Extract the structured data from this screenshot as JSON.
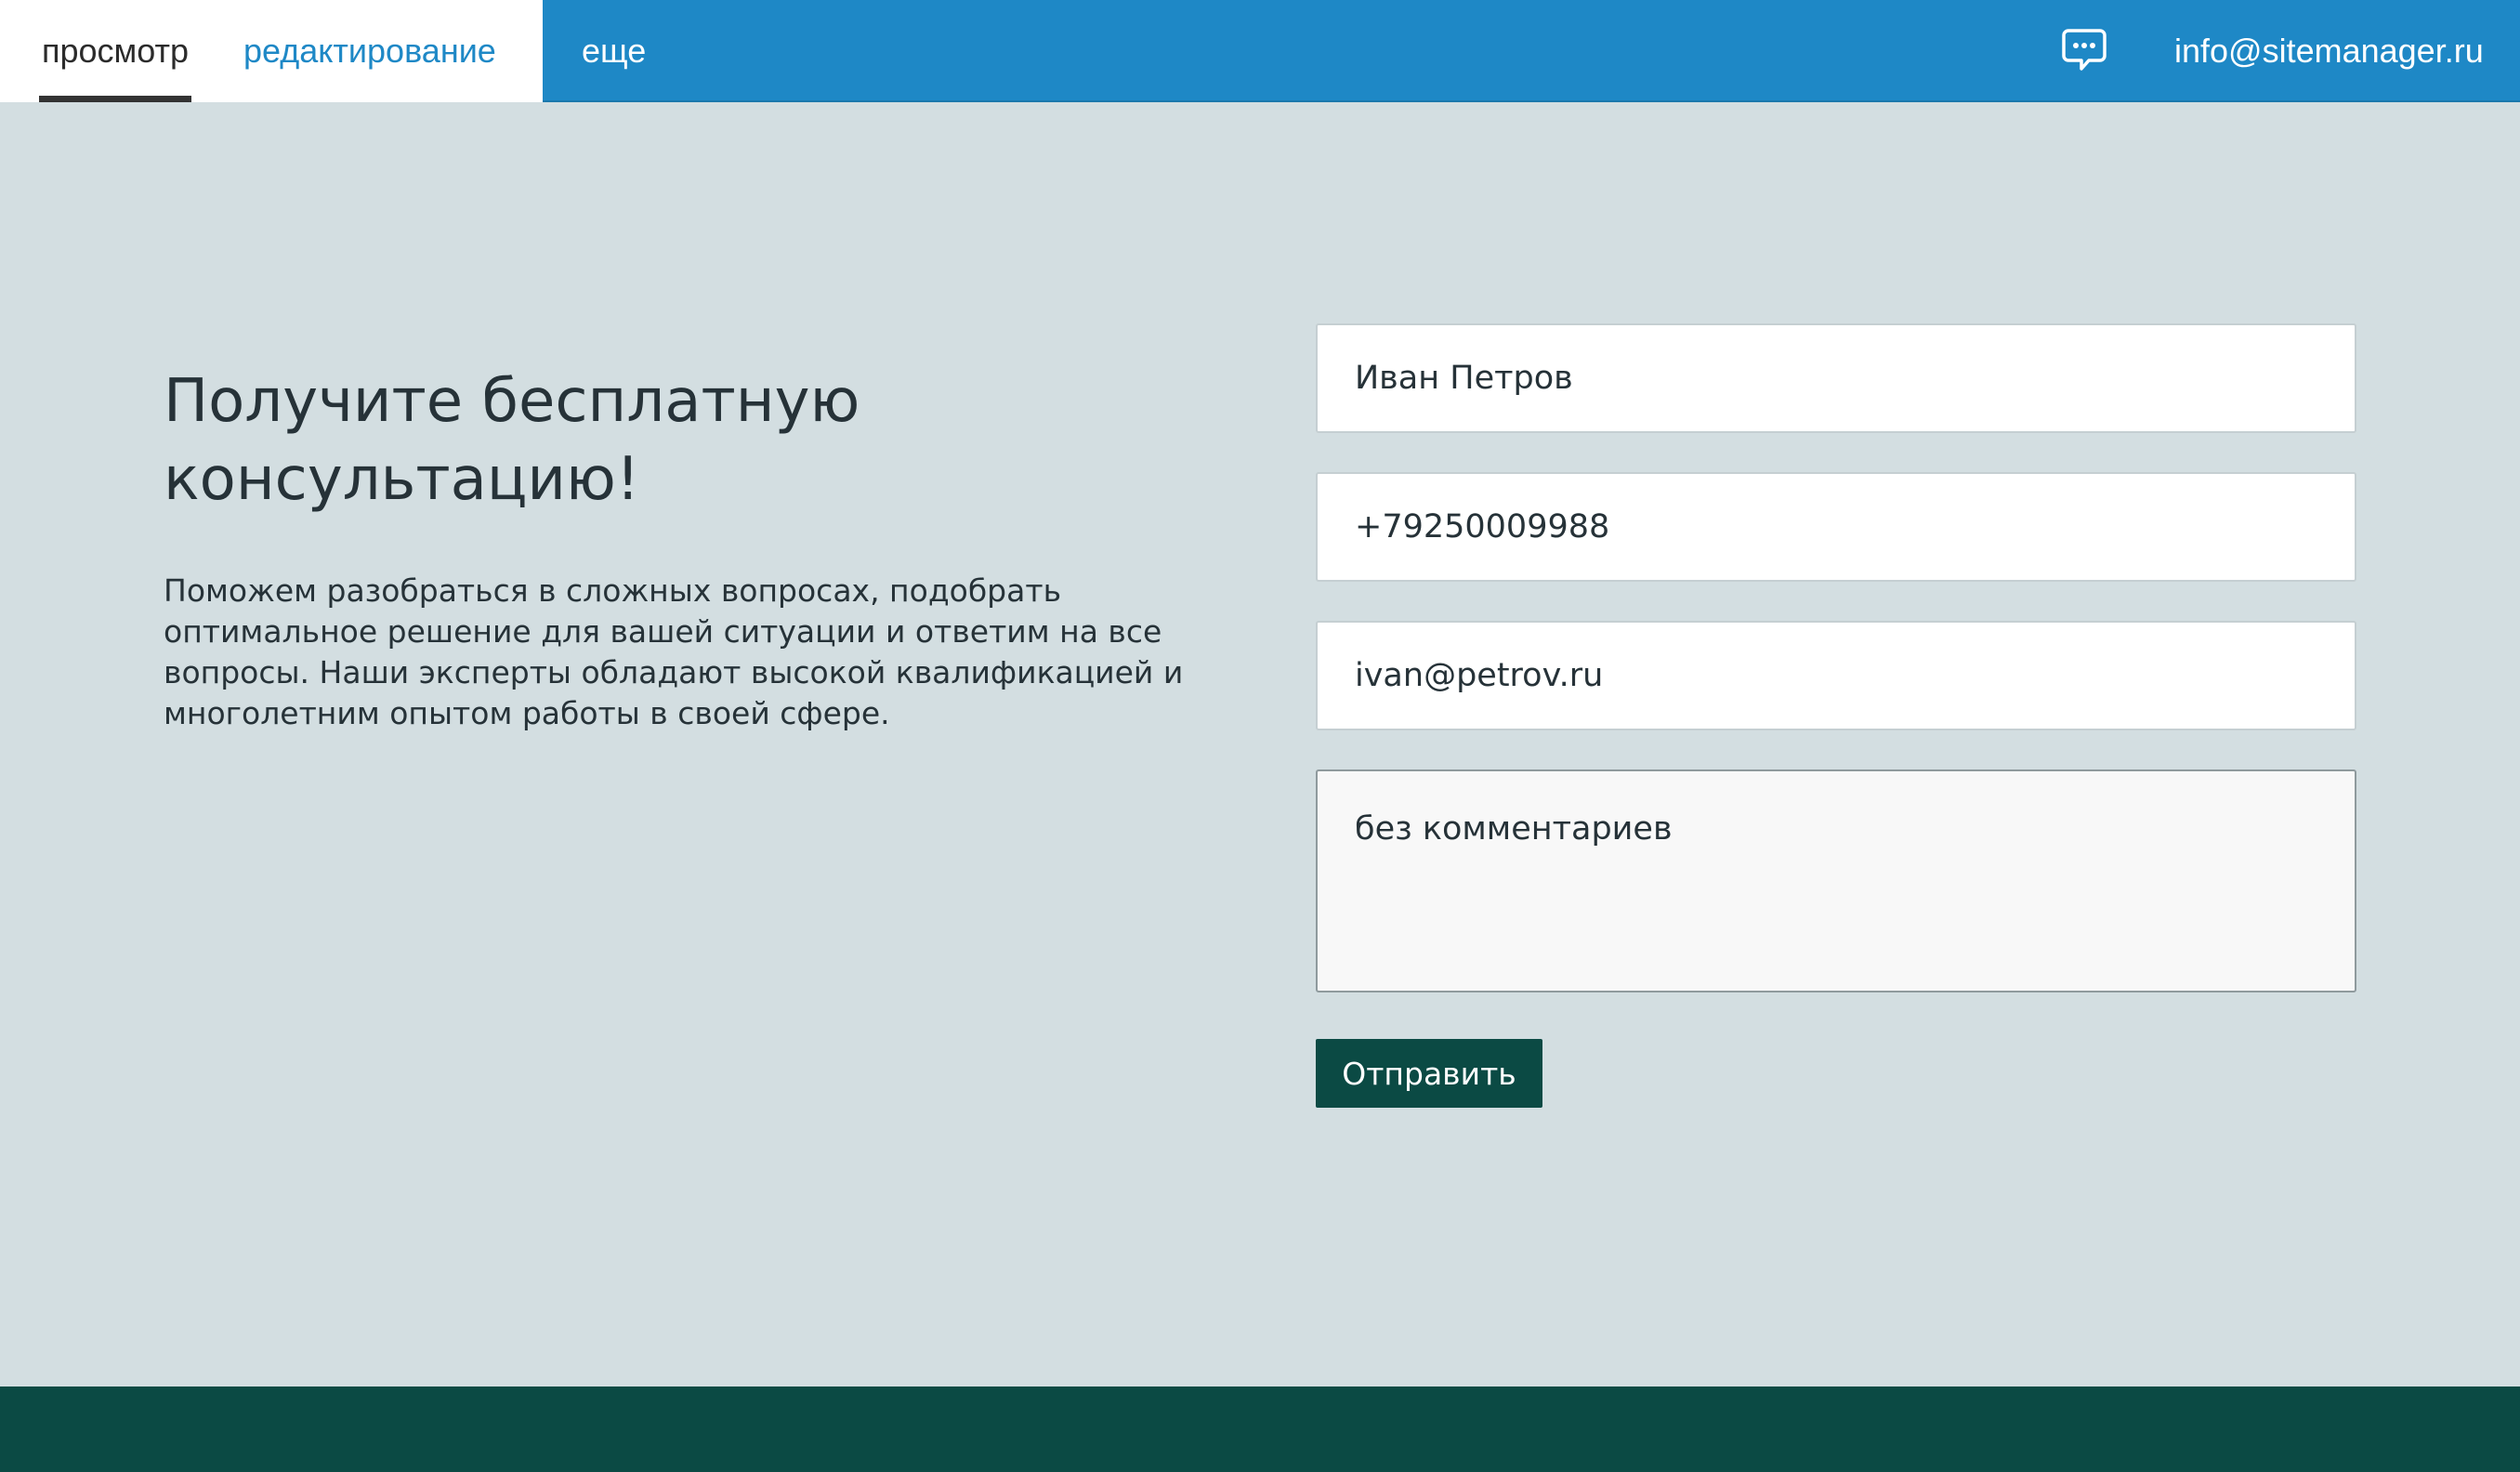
{
  "topbar": {
    "tabs": [
      {
        "label": "просмотр",
        "active": true
      },
      {
        "label": "редактирование",
        "active": false
      },
      {
        "label": "еще",
        "active": false
      }
    ],
    "chat_icon": "chat-bubble-icon",
    "account_email": "info@sitemanager.ru",
    "accent_color": "#1e88c6"
  },
  "content": {
    "headline": "Получите бесплатную консультацию!",
    "description": "Поможем разобраться в сложных вопросах, подобрать оптимальное решение для вашей ситуации и ответим на все вопросы. Наши эксперты обладают высокой квалификацией и многолетним опытом работы в своей сфере."
  },
  "form": {
    "name_value": "Иван Петров",
    "phone_value": "+79250009988",
    "email_value": "ivan@petrov.ru",
    "comment_value": "без комментариев",
    "submit_label": "Отправить",
    "submit_color": "#0b4a44"
  }
}
